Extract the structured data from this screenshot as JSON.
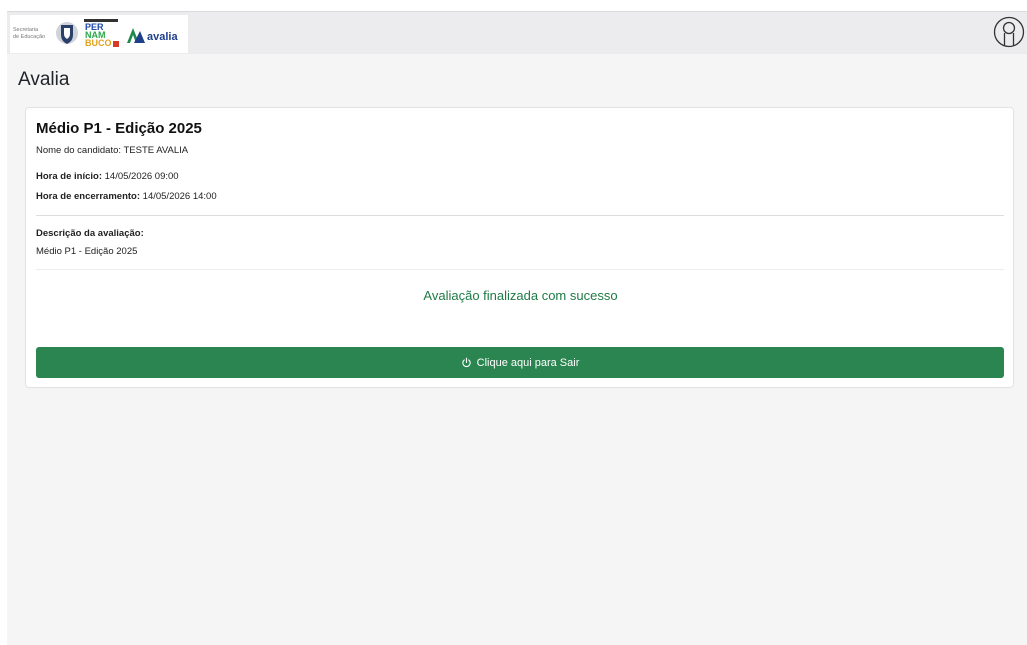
{
  "header": {
    "logo": {
      "secretaria": [
        "Secretaria",
        "de Educação"
      ],
      "pernambuco": [
        "PER",
        "NAM",
        "BUCO"
      ],
      "avalia": "avalia"
    },
    "user_icon": "user-circle-icon"
  },
  "page": {
    "title": "Avalia"
  },
  "card": {
    "title": "Médio P1 - Edição 2025",
    "candidate_label": "Nome do candidato:",
    "candidate_value": "TESTE AVALIA",
    "start_label": "Hora de início:",
    "start_value": "14/05/2026 09:00",
    "end_label": "Hora de encerramento:",
    "end_value": "14/05/2026 14:00",
    "description_label": "Descrição da avaliação:",
    "description_value": "Médio P1 - Edição 2025",
    "success_message": "Avaliação finalizada com sucesso",
    "exit_button": {
      "label": "Clique aqui para Sair",
      "icon": "power-icon"
    }
  },
  "colors": {
    "accent_green": "#2b8550",
    "success_text": "#1f7a45",
    "topbar": "#ececee",
    "background": "#f5f5f6"
  }
}
